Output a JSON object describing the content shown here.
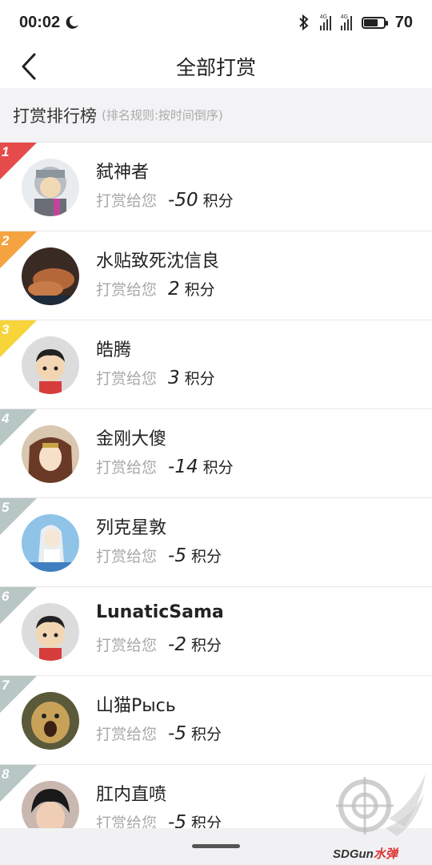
{
  "status_bar": {
    "time": "00:02",
    "signal_tag": "4G",
    "battery": "70",
    "battery_level": 0.7
  },
  "nav": {
    "title": "全部打赏"
  },
  "section": {
    "title": "打赏排行榜",
    "hint": "(排名规则:按时间倒序)"
  },
  "reward_label": "打赏给您",
  "reward_unit": "积分",
  "rank_colors": [
    "#e64b4b",
    "#f5a340",
    "#f6d43a",
    "#b8c6c4"
  ],
  "items": [
    {
      "rank": "1",
      "name": "弑神者",
      "amount": "-50"
    },
    {
      "rank": "2",
      "name": "水贴致死沈信良",
      "amount": "2"
    },
    {
      "rank": "3",
      "name": "皓腾",
      "amount": "3"
    },
    {
      "rank": "4",
      "name": "金刚大傻",
      "amount": "-14"
    },
    {
      "rank": "5",
      "name": "列克星敦",
      "amount": "-5"
    },
    {
      "rank": "6",
      "name": "LunaticSama",
      "amount": "-2"
    },
    {
      "rank": "7",
      "name": "山猫Рысь",
      "amount": "-5"
    },
    {
      "rank": "8",
      "name": "肛内直喷",
      "amount": "-5"
    }
  ],
  "watermark": {
    "brand": "SDGun",
    "suffix": "水弹"
  }
}
